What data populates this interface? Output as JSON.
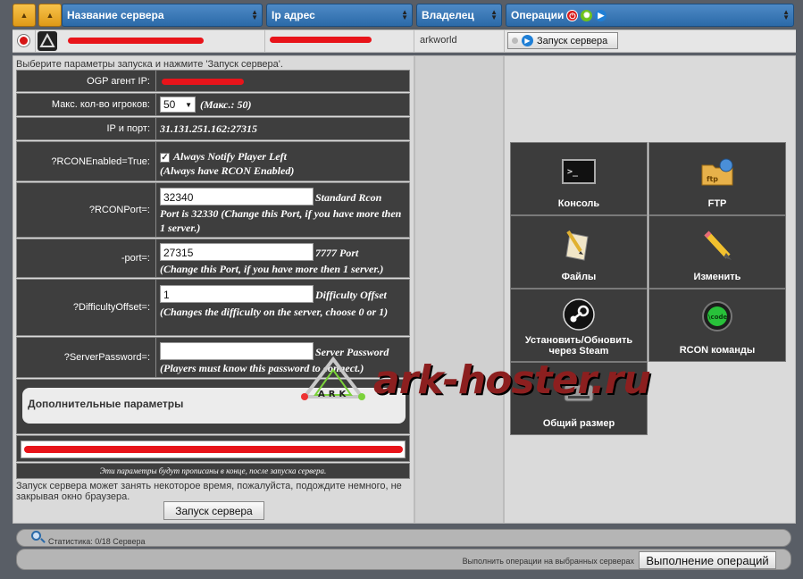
{
  "header": {
    "server_name": "Название сервера",
    "ip_address": "Ip адрес",
    "owner": "Владелец",
    "operations": "Операции"
  },
  "server_row": {
    "owner": "arkworld",
    "start_button": "Запуск сервера"
  },
  "form": {
    "hint": "Выберите параметры запуска и нажмите 'Запуск сервера'.",
    "agent_ip_label": "OGP агент IP:",
    "max_players_label": "Макс. кол-во игроков:",
    "max_players_value": "50",
    "max_players_note": "(Макс.: 50)",
    "ip_port_label": "IP и порт:",
    "ip_port_value": "31.131.251.162:27315",
    "rcon_enabled_label": "?RCONEnabled=True:",
    "rcon_enabled_text": "Always Notify Player Left",
    "rcon_enabled_note": "(Always have RCON Enabled)",
    "rcon_port_label": "?RCONPort=:",
    "rcon_port_value": "32340",
    "rcon_port_text": "Standard Rcon",
    "rcon_port_note": "Port is 32330 (Change this Port, if you have more then 1 server.)",
    "port_label": "-port=:",
    "port_value": "27315",
    "port_text": "7777 Port",
    "port_note": "(Change this Port, if you have more then 1 server.)",
    "difficulty_label": "?DifficultyOffset=:",
    "difficulty_value": "1",
    "difficulty_text": "Difficulty Offset",
    "difficulty_note": "(Changes the difficulty on the server, choose 0 or 1)",
    "password_label": "?ServerPassword=:",
    "password_value": "",
    "password_text": "Server Password",
    "password_note": "(Players must know this password to connect.)",
    "extra_params_title": "Дополнительные параметры",
    "extra_params_note": "Эти параметры будут прописаны в конце, после запуска сервера.",
    "start_note": "Запуск сервера может занять некоторое время, пожалуйста, подождите немного, не закрывая окно браузера.",
    "start_button": "Запуск сервера"
  },
  "tiles": [
    {
      "label": "Консоль",
      "icon": "console-icon"
    },
    {
      "label": "FTP",
      "icon": "ftp-folder-icon"
    },
    {
      "label": "Файлы",
      "icon": "files-icon"
    },
    {
      "label": "Изменить",
      "icon": "pencil-icon"
    },
    {
      "label": "Установить/Обновить через Steam",
      "icon": "steam-icon"
    },
    {
      "label": "RCON команды",
      "icon": "rcon-icon"
    },
    {
      "label": "Общий размер",
      "icon": "disk-size-icon"
    }
  ],
  "footer": {
    "stats": "Статистика: 0/18 Сервера",
    "bulk_hint": "Выполнить операции на выбранных серверах",
    "bulk_button": "Выполнение операций"
  },
  "watermark": {
    "text": "ark-hoster.ru",
    "logo_text": "ARK"
  },
  "colors": {
    "header_blue": "#2b6aa8",
    "sort_orange": "#e09a17",
    "redaction": "#e8141a",
    "dark_panel": "#3e3e3e"
  }
}
